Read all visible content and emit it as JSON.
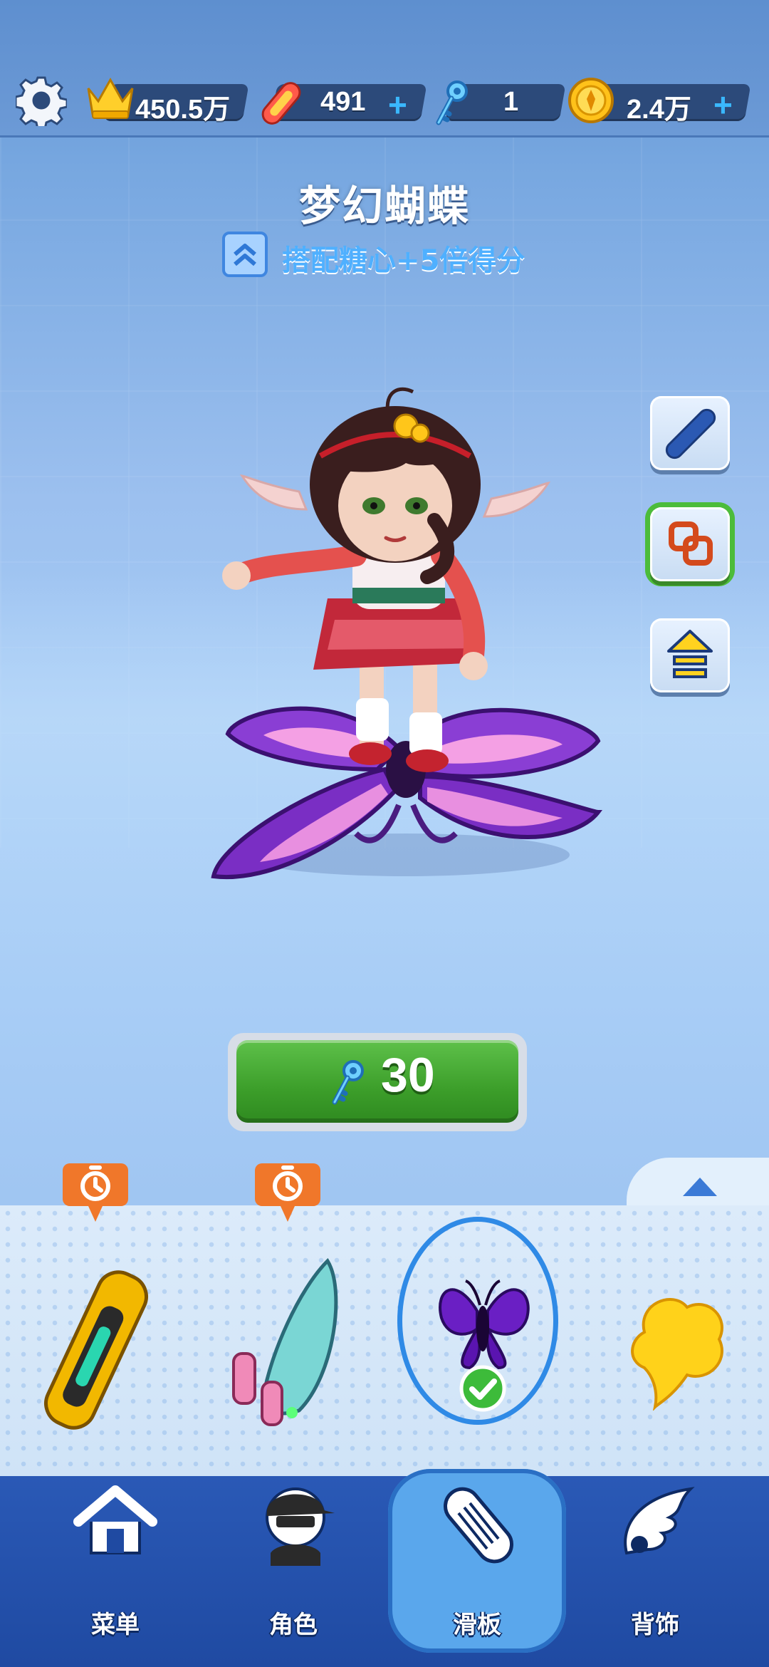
{
  "top_bar": {
    "settings_icon": "gear-icon",
    "resources": [
      {
        "name": "score",
        "icon": "crown-icon",
        "value": "450.5万",
        "has_plus": false
      },
      {
        "name": "hoverboards",
        "icon": "hoverboard-icon",
        "value": "491",
        "has_plus": true
      },
      {
        "name": "keys",
        "icon": "key-icon",
        "value": "1",
        "has_plus": true
      },
      {
        "name": "coins",
        "icon": "coin-icon",
        "value": "2.4万",
        "has_plus": true
      }
    ],
    "plus_label": "+"
  },
  "item": {
    "title": "梦幻蝴蝶",
    "bonus": "搭配糖心+5倍得分",
    "price": "30",
    "price_icon": "key-icon"
  },
  "side_buttons": [
    {
      "name": "board-view-button",
      "icon": "board-icon",
      "selected": false
    },
    {
      "name": "combo-button",
      "icon": "link-squares-icon",
      "selected": true
    },
    {
      "name": "upgrade-button",
      "icon": "arrow-up-icon",
      "selected": false
    }
  ],
  "tray": {
    "toggle_icon": "chevron-up-icon",
    "items": [
      {
        "name": "golden-rocket-board",
        "timer": true,
        "selected": false
      },
      {
        "name": "teal-rocket-board",
        "timer": true,
        "selected": false
      },
      {
        "name": "purple-butterfly-board",
        "timer": false,
        "selected": true,
        "equipped": true
      },
      {
        "name": "yellow-cloud-board",
        "timer": false,
        "selected": false
      }
    ]
  },
  "nav": {
    "items": [
      {
        "label": "菜单",
        "icon": "home-icon",
        "active": false
      },
      {
        "label": "角色",
        "icon": "character-icon",
        "active": false
      },
      {
        "label": "滑板",
        "icon": "skateboard-icon",
        "active": true
      },
      {
        "label": "背饰",
        "icon": "wings-icon",
        "active": false
      }
    ]
  },
  "colors": {
    "accent_blue": "#3ab8ff",
    "buy_green": "#3c9e2a",
    "nav_blue": "#2a59b6",
    "timer_orange": "#f0772a"
  }
}
